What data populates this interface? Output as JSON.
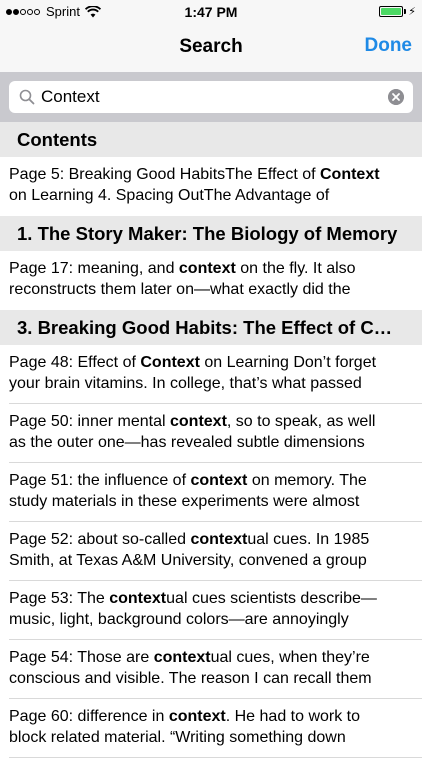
{
  "status_bar": {
    "carrier": "Sprint",
    "time": "1:47 PM",
    "signal_bars": 2,
    "battery_level": 1.0,
    "battery_color": "#4cd964"
  },
  "nav": {
    "title": "Search",
    "done_label": "Done",
    "accent_color": "#1f8ae6"
  },
  "search": {
    "value": "Context",
    "placeholder": ""
  },
  "results": [
    {
      "type": "header",
      "title": "Contents"
    },
    {
      "type": "row",
      "line1": [
        "Page 5: Breaking Good HabitsThe Effect of ",
        "Context",
        ""
      ],
      "line2": [
        "on Learning 4. Spacing OutThe Advantage of",
        "",
        ""
      ]
    },
    {
      "type": "header",
      "title": "1. The Story Maker: The Biology of Memory"
    },
    {
      "type": "row",
      "line1": [
        "Page 17: meaning, and ",
        "context",
        " on the fly. It also"
      ],
      "line2": [
        "reconstructs them later on—what exactly did the",
        "",
        ""
      ]
    },
    {
      "type": "header",
      "title": "3. Breaking Good Habits: The Effect of C…"
    },
    {
      "type": "row",
      "line1": [
        "Page 48: Effect of ",
        "Context",
        " on Learning Don’t forget"
      ],
      "line2": [
        "your brain vitamins. In college, that’s what passed",
        "",
        ""
      ]
    },
    {
      "type": "row",
      "line1": [
        "Page 50: inner mental ",
        "context",
        ", so to speak, as well"
      ],
      "line2": [
        "as the outer one—has revealed subtle dimensions",
        "",
        ""
      ]
    },
    {
      "type": "row",
      "line1": [
        "Page 51: the influence of ",
        "context",
        " on memory. The"
      ],
      "line2": [
        "study materials in these experiments were almost",
        "",
        ""
      ]
    },
    {
      "type": "row",
      "line1": [
        "Page 52: about so-called ",
        "context",
        "ual cues. In 1985"
      ],
      "line2": [
        "Smith, at Texas A&M University, convened a group",
        "",
        ""
      ]
    },
    {
      "type": "row",
      "line1": [
        "Page 53: The ",
        "context",
        "ual cues scientists describe—"
      ],
      "line2": [
        "music, light, background colors—are annoyingly",
        "",
        ""
      ]
    },
    {
      "type": "row",
      "line1": [
        "Page 54: Those are ",
        "context",
        "ual cues, when they’re"
      ],
      "line2": [
        "conscious and visible. The reason I can recall them",
        "",
        ""
      ]
    },
    {
      "type": "row",
      "line1": [
        "Page 60: difference in ",
        "context",
        ". He had to work to"
      ],
      "line2": [
        "block related material. “Writing something down",
        "",
        ""
      ]
    }
  ]
}
